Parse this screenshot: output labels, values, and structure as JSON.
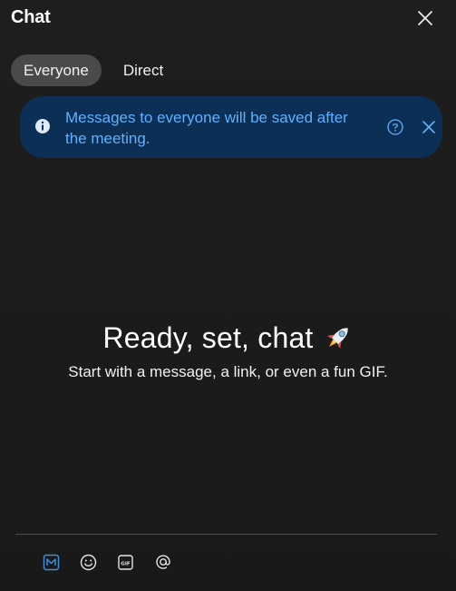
{
  "header": {
    "title": "Chat",
    "close_icon": "close-icon"
  },
  "tabs": [
    {
      "label": "Everyone",
      "active": true
    },
    {
      "label": "Direct",
      "active": false
    }
  ],
  "banner": {
    "message": "Messages to everyone will be saved after the meeting.",
    "info_icon": "info-icon",
    "help_icon": "help-icon",
    "close_icon": "close-icon"
  },
  "empty_state": {
    "title": "Ready, set, chat",
    "title_icon": "rocket-icon",
    "subtitle": "Start with a message, a link, or even a fun GIF."
  },
  "toolbar": {
    "items": [
      {
        "icon": "markdown-icon"
      },
      {
        "icon": "emoji-icon"
      },
      {
        "icon": "gif-icon",
        "text": "GIF"
      },
      {
        "icon": "mention-icon"
      }
    ]
  },
  "colors": {
    "background": "#1b1b1b",
    "active_tab": "#4a4a4a",
    "banner_bg": "#0c2f55",
    "banner_text": "#5fb0ff",
    "divider": "#4b4b4b",
    "accent": "#3d8fd9"
  }
}
